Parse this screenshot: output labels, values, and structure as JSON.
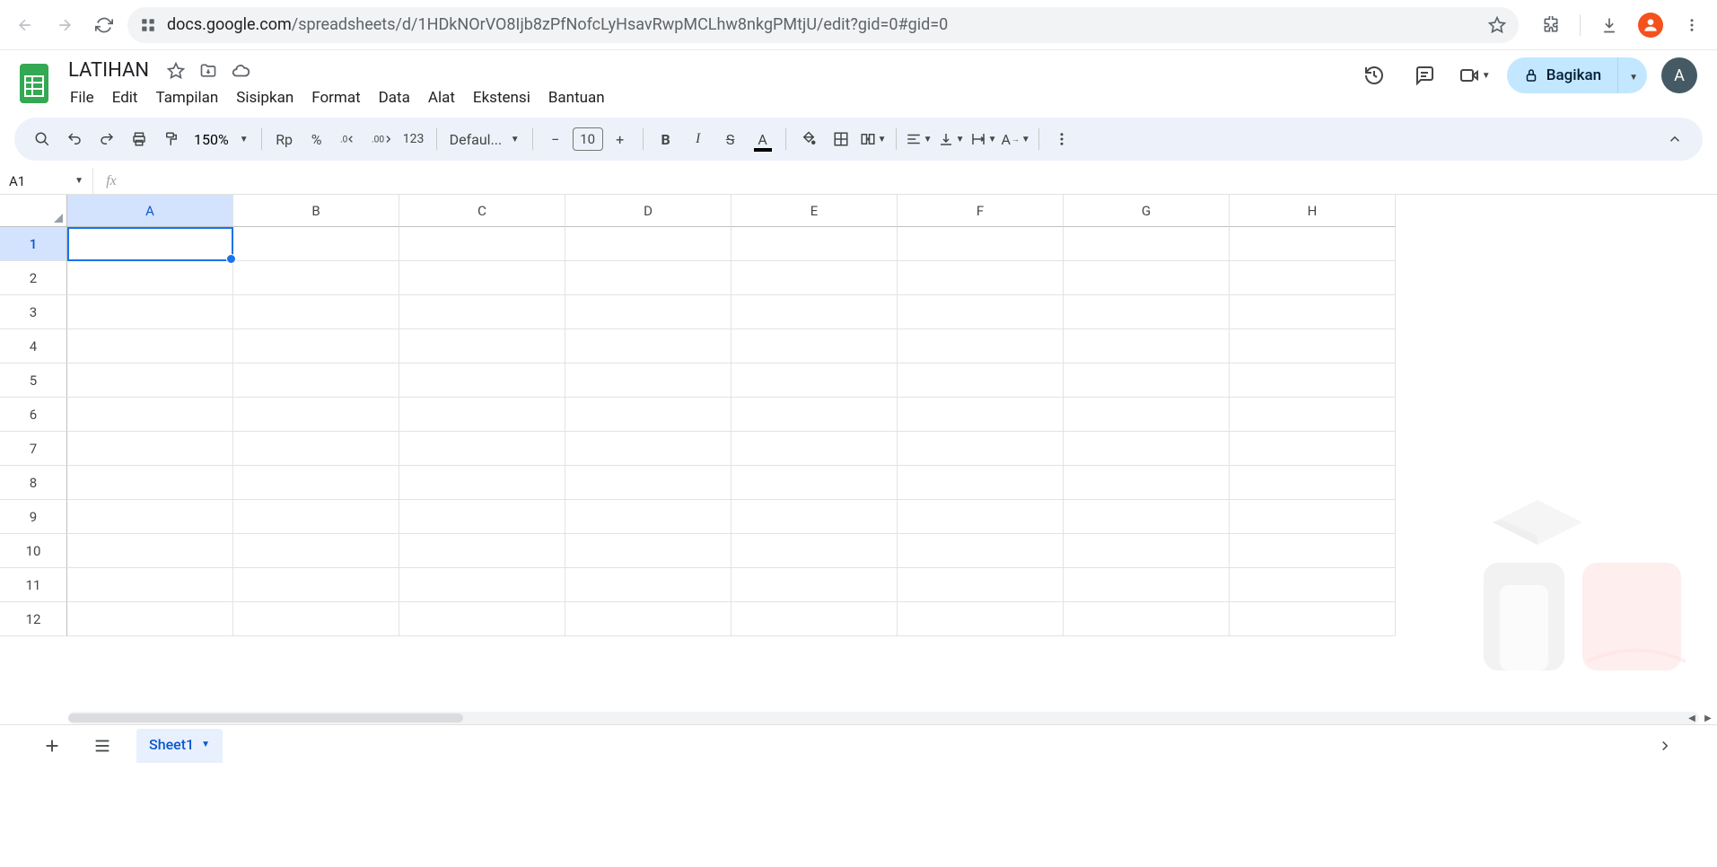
{
  "browser": {
    "url_domain": "docs.google.com",
    "url_path": "/spreadsheets/d/1HDkNOrVO8Ijb8zPfNofcLyHsavRwpMCLhw8nkgPMtjU/edit?gid=0#gid=0"
  },
  "doc": {
    "title": "LATIHAN"
  },
  "menus": [
    "File",
    "Edit",
    "Tampilan",
    "Sisipkan",
    "Format",
    "Data",
    "Alat",
    "Ekstensi",
    "Bantuan"
  ],
  "toolbar": {
    "zoom": "150%",
    "currency": "Rp",
    "percent": "%",
    "numfmt": "123",
    "font": "Defaul...",
    "font_size": "10"
  },
  "share": {
    "label": "Bagikan"
  },
  "avatar": {
    "letter": "A"
  },
  "namebox": "A1",
  "columns": [
    "A",
    "B",
    "C",
    "D",
    "E",
    "F",
    "G",
    "H"
  ],
  "rows": [
    "1",
    "2",
    "3",
    "4",
    "5",
    "6",
    "7",
    "8",
    "9",
    "10",
    "11",
    "12"
  ],
  "active_cell": {
    "row": 0,
    "col": 0
  },
  "sheet_tab": "Sheet1"
}
